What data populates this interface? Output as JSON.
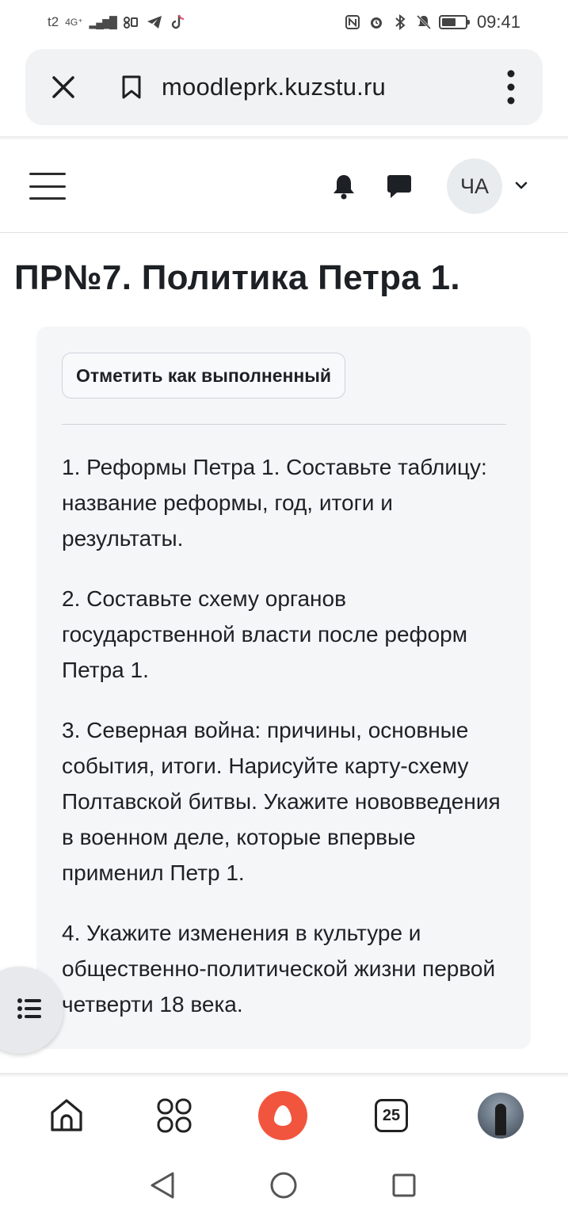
{
  "status_bar": {
    "carrier": "t2",
    "network": "4G⁺",
    "signal": "▂▄▆█",
    "time": "09:41",
    "battery_level": 0.6
  },
  "browser": {
    "url": "moodleprk.kuzstu.ru",
    "close_icon": "close-icon",
    "bookmark_icon": "bookmark-icon",
    "menu_icon": "more-vert-icon"
  },
  "navbar": {
    "avatar_initials": "ЧА"
  },
  "page": {
    "title": "ПР№7. Политика Петра 1.",
    "complete_button": "Отметить как выполненный",
    "tasks": [
      "1. Реформы Петра 1. Составьте таблицу: название реформы, год, итоги и результаты.",
      "2. Составьте схему органов государственной власти после реформ Петра 1.",
      "3. Северная война: причины, основные события, итоги. Нарисуйте карту-схему Полтавской битвы. Укажите нововведения в военном деле, которые впервые применил Петр 1.",
      "4. Укажите изменения в культуре и общественно-политической жизни первой четверти 18 века."
    ]
  },
  "bottom_bar": {
    "tabs_count": "25"
  },
  "colors": {
    "alice_accent": "#f2553e",
    "card_background": "#f5f6f8"
  }
}
